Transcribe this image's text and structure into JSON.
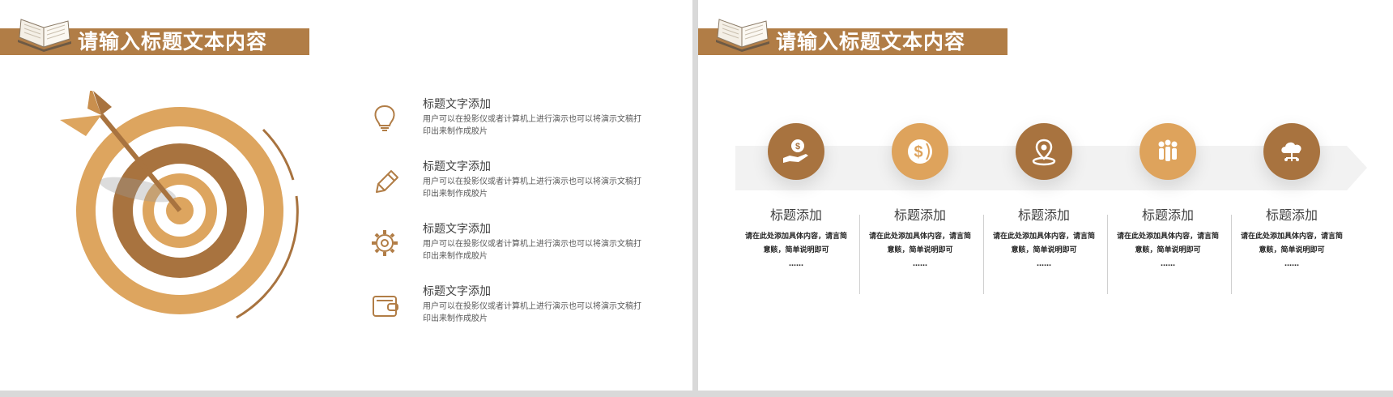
{
  "left_slide": {
    "title": "请输入标题文本内容",
    "features": [
      {
        "icon": "lightbulb-icon",
        "title": "标题文字添加",
        "desc": "用户可以在投影仪或者计算机上进行演示也可以将演示文稿打印出来制作成胶片"
      },
      {
        "icon": "pencil-icon",
        "title": "标题文字添加",
        "desc": "用户可以在投影仪或者计算机上进行演示也可以将演示文稿打印出来制作成胶片"
      },
      {
        "icon": "gear-icon",
        "title": "标题文字添加",
        "desc": "用户可以在投影仪或者计算机上进行演示也可以将演示文稿打印出来制作成胶片"
      },
      {
        "icon": "wallet-icon",
        "title": "标题文字添加",
        "desc": "用户可以在投影仪或者计算机上进行演示也可以将演示文稿打印出来制作成胶片"
      }
    ]
  },
  "right_slide": {
    "title": "请输入标题文本内容",
    "steps": [
      {
        "icon": "money-hand-icon",
        "title": "标题添加",
        "desc": "请在此处添加具体内容，请言简意赅，简单说明即可",
        "more": "……"
      },
      {
        "icon": "dollar-globe-icon",
        "title": "标题添加",
        "desc": "请在此处添加具体内容，请言简意赅，简单说明即可",
        "more": "……"
      },
      {
        "icon": "location-pin-icon",
        "title": "标题添加",
        "desc": "请在此处添加具体内容，请言简意赅，简单说明即可",
        "more": "……"
      },
      {
        "icon": "people-group-icon",
        "title": "标题添加",
        "desc": "请在此处添加具体内容，请言简意赅，简单说明即可",
        "more": "……"
      },
      {
        "icon": "cloud-network-icon",
        "title": "标题添加",
        "desc": "请在此处添加具体内容，请言简意赅，简单说明即可",
        "more": "……"
      }
    ]
  },
  "colors": {
    "brand_dark": "#a8733f",
    "brand_light": "#dea35c",
    "title_bar": "#b17d46"
  }
}
